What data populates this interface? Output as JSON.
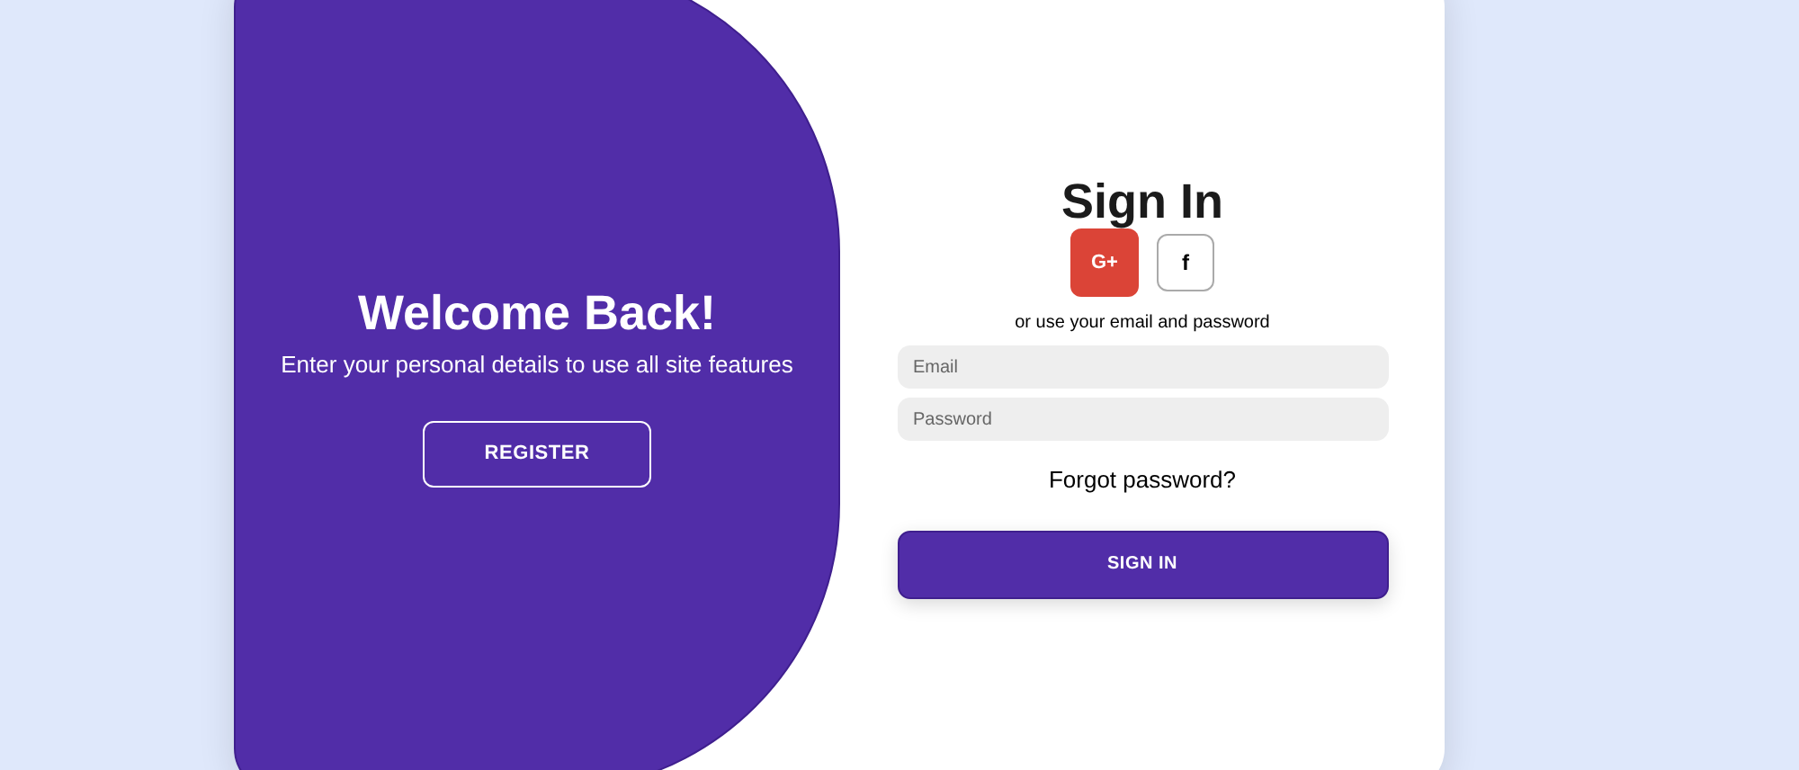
{
  "welcome": {
    "title": "Welcome Back!",
    "subtitle": "Enter your personal details to use all site features",
    "button": "REGISTER"
  },
  "sign_in": {
    "title": "Sign In",
    "social": [
      {
        "label": "G+",
        "color": "#db4437"
      },
      {
        "label": "f",
        "color": "#ffffff"
      }
    ],
    "hint": "or use your email and password",
    "fields": [
      {
        "placeholder": "Email"
      },
      {
        "placeholder": "Password"
      }
    ],
    "forgot": "Forgot password?",
    "button": "SIGN IN"
  }
}
